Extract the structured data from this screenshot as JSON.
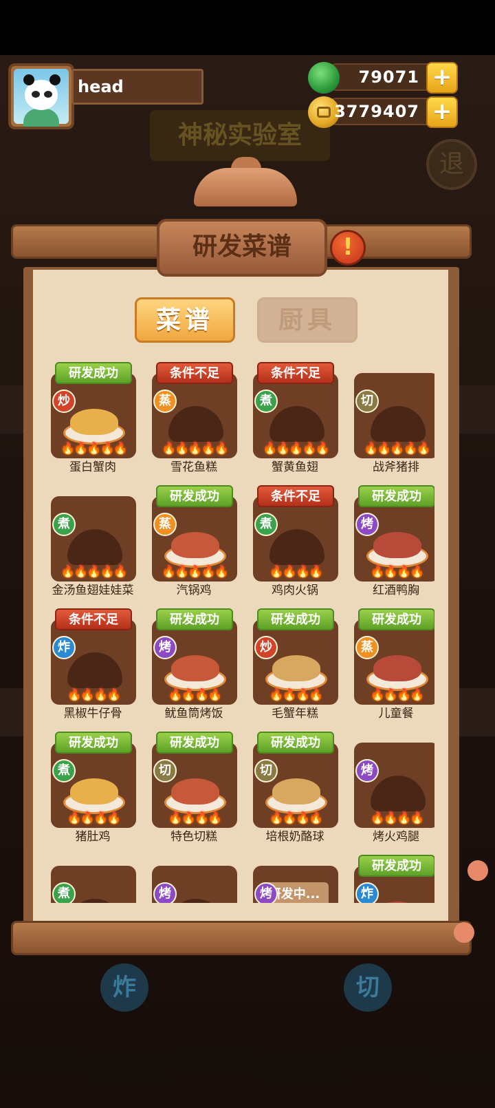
{
  "header": {
    "username": "head",
    "gems": "79071",
    "coins": "3779407",
    "plus_label": "+"
  },
  "background": {
    "lab_title": "神秘实验室",
    "exit_label": "退",
    "stove_left_label": "炸",
    "stove_right_label": "切"
  },
  "panel": {
    "title": "研发菜谱",
    "warn_label": "!",
    "tabs": [
      {
        "label": "菜谱",
        "active": true
      },
      {
        "label": "厨具",
        "active": false
      }
    ]
  },
  "recipes": [
    {
      "name": "蛋白蟹肉",
      "method": "炒",
      "status": "研发成功",
      "flames": "🔥🔥🔥🔥🔥",
      "unlocked": true
    },
    {
      "name": "雪花鱼糕",
      "method": "蒸",
      "status": "条件不足",
      "flames": "🔥🔥🔥🔥🔥",
      "unlocked": false
    },
    {
      "name": "蟹黄鱼翅",
      "method": "煮",
      "status": "条件不足",
      "flames": "🔥🔥🔥🔥🔥",
      "unlocked": false
    },
    {
      "name": "战斧猪排",
      "method": "切",
      "status": "",
      "flames": "🔥🔥🔥🔥🔥",
      "unlocked": false
    },
    {
      "name": "金汤鱼翅娃娃菜",
      "method": "煮",
      "status": "",
      "flames": "🔥🔥🔥🔥🔥",
      "unlocked": false
    },
    {
      "name": "汽锅鸡",
      "method": "蒸",
      "status": "研发成功",
      "flames": "🔥🔥🔥🔥🔥",
      "unlocked": true
    },
    {
      "name": "鸡肉火锅",
      "method": "煮",
      "status": "条件不足",
      "flames": "🔥🔥🔥🔥",
      "unlocked": false
    },
    {
      "name": "红酒鸭胸",
      "method": "烤",
      "status": "研发成功",
      "flames": "🔥🔥🔥🔥",
      "unlocked": true
    },
    {
      "name": "黑椒牛仔骨",
      "method": "炸",
      "status": "条件不足",
      "flames": "🔥🔥🔥🔥",
      "unlocked": false
    },
    {
      "name": "鱿鱼筒烤饭",
      "method": "烤",
      "status": "研发成功",
      "flames": "🔥🔥🔥🔥",
      "unlocked": true
    },
    {
      "name": "毛蟹年糕",
      "method": "炒",
      "status": "研发成功",
      "flames": "🔥🔥🔥🔥",
      "unlocked": true
    },
    {
      "name": "儿童餐",
      "method": "蒸",
      "status": "研发成功",
      "flames": "🔥🔥🔥🔥",
      "unlocked": true
    },
    {
      "name": "猪肚鸡",
      "method": "煮",
      "status": "研发成功",
      "flames": "🔥🔥🔥🔥",
      "unlocked": true
    },
    {
      "name": "特色切糕",
      "method": "切",
      "status": "研发成功",
      "flames": "🔥🔥🔥🔥",
      "unlocked": true
    },
    {
      "name": "培根奶酪球",
      "method": "切",
      "status": "研发成功",
      "flames": "🔥🔥🔥🔥",
      "unlocked": true
    },
    {
      "name": "烤火鸡腿",
      "method": "烤",
      "status": "",
      "flames": "🔥🔥🔥🔥",
      "unlocked": false
    },
    {
      "name": "",
      "method": "煮",
      "status": "",
      "flames": "",
      "unlocked": false
    },
    {
      "name": "",
      "method": "烤",
      "status": "",
      "flames": "",
      "unlocked": false
    },
    {
      "name": "",
      "method": "烤",
      "status": "",
      "flames": "",
      "unlocked": false,
      "progress": "研发中..."
    },
    {
      "name": "",
      "method": "炸",
      "status": "研发成功",
      "flames": "",
      "unlocked": true
    }
  ],
  "colors": {
    "success_ribbon": "#7ab83a",
    "fail_ribbon": "#c8401f",
    "panel_bg": "#ecd9bc",
    "card_bg": "#6e3f24"
  }
}
